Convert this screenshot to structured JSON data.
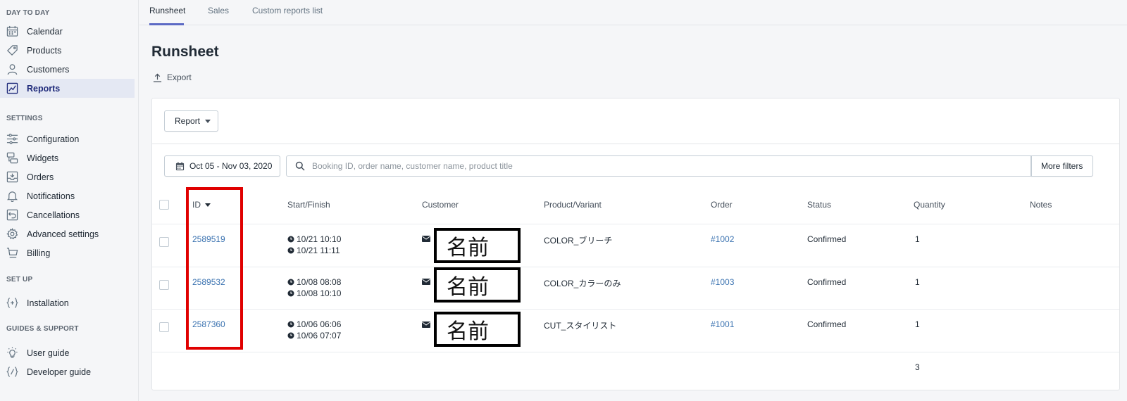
{
  "sidebar": {
    "sections": [
      {
        "title": "DAY TO DAY"
      },
      {
        "title": "SETTINGS"
      },
      {
        "title": "SET UP"
      },
      {
        "title": "GUIDES & SUPPORT"
      }
    ],
    "items": [
      {
        "label": "Calendar",
        "icon": "calendar-icon"
      },
      {
        "label": "Products",
        "icon": "tag-icon"
      },
      {
        "label": "Customers",
        "icon": "person-icon"
      },
      {
        "label": "Reports",
        "icon": "chart-icon",
        "active": true
      },
      {
        "label": "Configuration",
        "icon": "sliders-icon"
      },
      {
        "label": "Widgets",
        "icon": "widgets-icon"
      },
      {
        "label": "Orders",
        "icon": "inbox-icon"
      },
      {
        "label": "Notifications",
        "icon": "bell-icon"
      },
      {
        "label": "Cancellations",
        "icon": "cancel-icon"
      },
      {
        "label": "Advanced settings",
        "icon": "gear-icon"
      },
      {
        "label": "Billing",
        "icon": "cart-icon"
      },
      {
        "label": "Installation",
        "icon": "code-braces-icon"
      },
      {
        "label": "User guide",
        "icon": "lightbulb-icon"
      },
      {
        "label": "Developer guide",
        "icon": "code-slash-icon"
      }
    ]
  },
  "tabs": [
    {
      "label": "Runsheet",
      "active": true
    },
    {
      "label": "Sales"
    },
    {
      "label": "Custom reports list"
    }
  ],
  "page": {
    "title": "Runsheet",
    "export_label": "Export"
  },
  "toolbar": {
    "report_label": "Report",
    "date_range": "Oct 05 - Nov 03, 2020",
    "search_placeholder": "Booking ID, order name, customer name, product title",
    "more_filters_label": "More filters"
  },
  "table": {
    "columns": [
      "ID",
      "Start/Finish",
      "Customer",
      "Product/Variant",
      "Order",
      "Status",
      "Quantity",
      "Notes"
    ],
    "rows": [
      {
        "id": "2589519",
        "start": "10/21 10:10",
        "finish": "10/21 11:11",
        "customer": "名前",
        "product": "COLOR_ブリーチ",
        "order": "#1002",
        "status": "Confirmed",
        "quantity": "1"
      },
      {
        "id": "2589532",
        "start": "10/08 08:08",
        "finish": "10/08 10:10",
        "customer": "名前",
        "product": "COLOR_カラーのみ",
        "order": "#1003",
        "status": "Confirmed",
        "quantity": "1"
      },
      {
        "id": "2587360",
        "start": "10/06 06:06",
        "finish": "10/06 07:07",
        "customer": "名前",
        "product": "CUT_スタイリスト",
        "order": "#1001",
        "status": "Confirmed",
        "quantity": "1"
      }
    ],
    "total_quantity": "3"
  },
  "colors": {
    "accent": "#5c6ac4",
    "link": "#3a72b0",
    "highlight": "#e00000",
    "active_nav_bg": "#e4e8f3"
  }
}
